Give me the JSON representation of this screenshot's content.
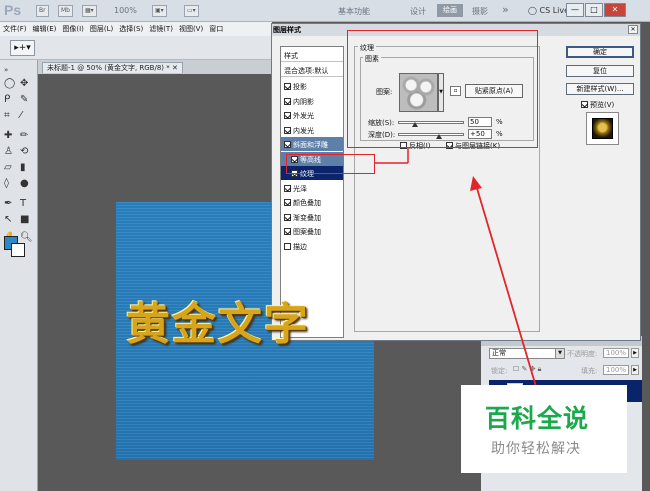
{
  "titlebar": {
    "app_logo": "Ps",
    "zoom": "100%",
    "workspaces": [
      "基本功能",
      "设计",
      "绘画",
      "摄影"
    ],
    "overflow": "»",
    "cs_live": "CS Live",
    "win_buttons": [
      "—",
      "□",
      "✕"
    ]
  },
  "menubar": {
    "items": [
      "文件(F)",
      "编辑(E)",
      "图像(I)",
      "图层(L)",
      "选择(S)",
      "滤镜(T)",
      "视图(V)",
      "窗口"
    ]
  },
  "document": {
    "tab_label": "未标题-1 @ 50% (黄金文字, RGB/8) * ✕",
    "canvas_text": "黄金文字"
  },
  "dialog": {
    "title": "图层样式",
    "close": "✕",
    "styles_header": "样式",
    "blending_header": "混合选项:默认",
    "style_items": [
      {
        "label": "投影",
        "checked": true,
        "sub": false,
        "state": "normal"
      },
      {
        "label": "内阴影",
        "checked": true,
        "sub": false,
        "state": "normal"
      },
      {
        "label": "外发光",
        "checked": true,
        "sub": false,
        "state": "normal"
      },
      {
        "label": "内发光",
        "checked": true,
        "sub": false,
        "state": "normal"
      },
      {
        "label": "斜面和浮雕",
        "checked": true,
        "sub": false,
        "state": "active"
      },
      {
        "label": "等高线",
        "checked": true,
        "sub": true,
        "state": "active"
      },
      {
        "label": "纹理",
        "checked": true,
        "sub": true,
        "state": "selected"
      },
      {
        "label": "光泽",
        "checked": true,
        "sub": false,
        "state": "normal"
      },
      {
        "label": "颜色叠加",
        "checked": true,
        "sub": false,
        "state": "normal"
      },
      {
        "label": "渐变叠加",
        "checked": true,
        "sub": false,
        "state": "normal"
      },
      {
        "label": "图案叠加",
        "checked": true,
        "sub": false,
        "state": "normal"
      },
      {
        "label": "描边",
        "checked": false,
        "sub": false,
        "state": "normal"
      }
    ],
    "texture": {
      "legend": "纹理",
      "pattern_legend": "图素",
      "pattern_label": "图案:",
      "snap_button": "贴紧原点(A)",
      "scale_label": "缩放(S):",
      "scale_value": "50",
      "scale_unit": "%",
      "depth_label": "深度(D):",
      "depth_value": "+50",
      "depth_unit": "%",
      "invert_label": "反相(I)",
      "invert_checked": false,
      "link_label": "与图层链接(K)",
      "link_checked": true
    },
    "buttons": {
      "ok": "确定",
      "reset": "复位",
      "new_style": "新建样式(W)...",
      "preview_label": "预览(V)",
      "preview_checked": true
    }
  },
  "layers": {
    "blend_mode": "正常",
    "opacity_label": "不透明度:",
    "opacity_value": "100%",
    "lock_label": "锁定:",
    "fill_label": "填充:",
    "fill_value": "100%"
  },
  "watermark": {
    "title": "百科全说",
    "subtitle": "助你轻松解决"
  }
}
